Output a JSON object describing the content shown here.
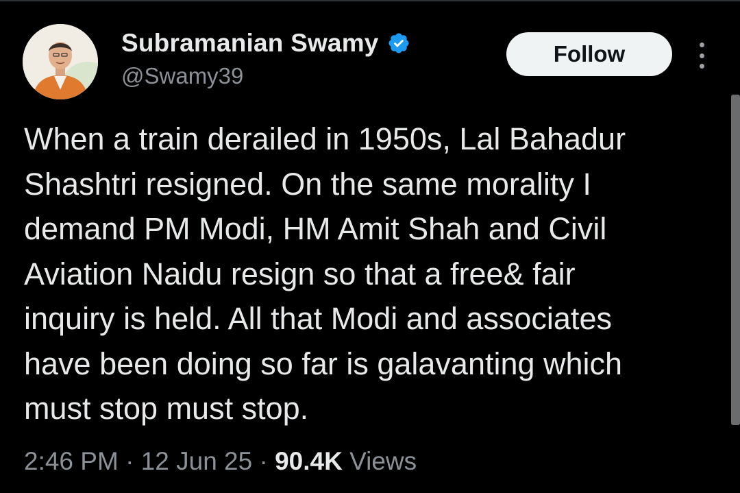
{
  "tweet": {
    "author": {
      "display_name": "Subramanian Swamy",
      "handle": "@Swamy39",
      "verified": true,
      "avatar_icon": "profile-photo"
    },
    "follow_label": "Follow",
    "more_icon": "more-options-icon",
    "text_lines": [
      "When a train derailed in 1950s, Lal Bahadur",
      "Shashtri resigned. On the same morality I",
      "demand PM Modi, HM Amit Shah and Civil",
      "Aviation Naidu resign so that a free& fair",
      "inquiry is held. All that Modi and associates",
      "have been doing so far is galavanting which",
      "must stop must stop."
    ],
    "meta": {
      "time": "2:46 PM",
      "separator": "·",
      "date": "12 Jun 25",
      "views_count": "90.4K",
      "views_label": "Views"
    }
  },
  "colors": {
    "background": "#000000",
    "text_primary": "#e7e9ea",
    "text_secondary": "#8b9197",
    "verified_blue": "#1d9bf0",
    "follow_bg": "#eff3f4"
  }
}
